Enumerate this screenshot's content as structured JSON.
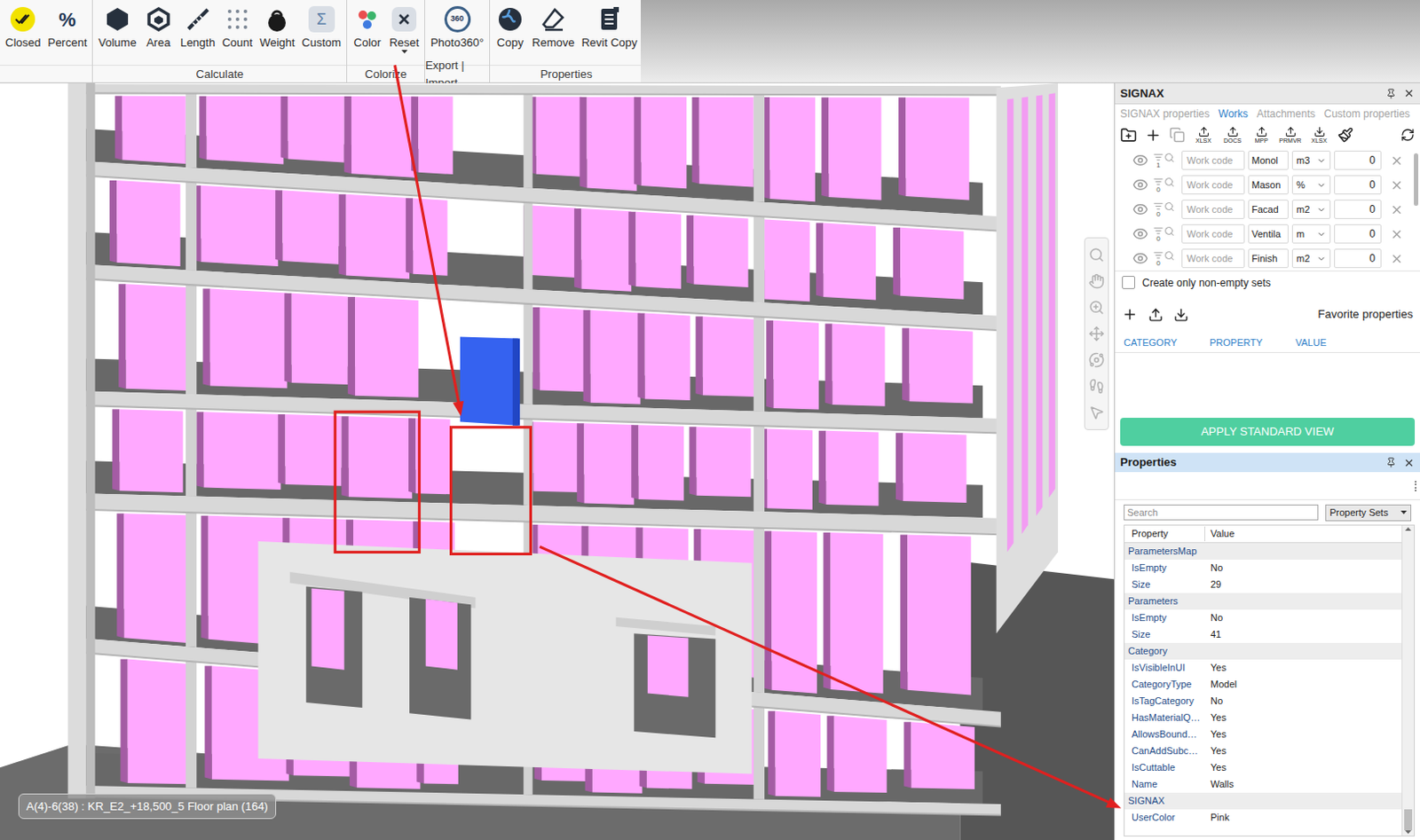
{
  "ribbon": {
    "groups": [
      {
        "buttons": [
          {
            "label": "Closed"
          },
          {
            "label": "Percent",
            "glyph": "%"
          }
        ]
      },
      {
        "label": "Calculate",
        "buttons": [
          {
            "label": "Volume"
          },
          {
            "label": "Area"
          },
          {
            "label": "Length"
          },
          {
            "label": "Count"
          },
          {
            "label": "Weight"
          },
          {
            "label": "Custom",
            "glyph": "Σ"
          }
        ]
      },
      {
        "label": "Colorize",
        "buttons": [
          {
            "label": "Color"
          },
          {
            "label": "Reset",
            "dropdown": true
          }
        ]
      },
      {
        "label": "Export | Import",
        "buttons": [
          {
            "label": "Photo360°",
            "glyph": "360"
          }
        ]
      },
      {
        "label": "Properties",
        "buttons": [
          {
            "label": "Copy"
          },
          {
            "label": "Remove"
          },
          {
            "label": "Revit Copy"
          }
        ]
      }
    ]
  },
  "viewport": {
    "status": "A(4)-6(38) : KR_E2_+18,500_5 Floor plan (164)"
  },
  "signax": {
    "title": "SIGNAX",
    "tabs": [
      {
        "label": "SIGNAX properties",
        "selected": false
      },
      {
        "label": "Works",
        "selected": true
      },
      {
        "label": "Attachments",
        "selected": false
      },
      {
        "label": "Custom properties",
        "selected": false
      }
    ],
    "transfers": [
      {
        "label": "XLSX",
        "kind": "upload"
      },
      {
        "label": "DOCS",
        "kind": "upload"
      },
      {
        "label": "MPP",
        "kind": "upload"
      },
      {
        "label": "PRMVR",
        "kind": "upload"
      },
      {
        "label": "XLSX",
        "kind": "download"
      }
    ],
    "works": [
      {
        "count": "1",
        "code": "Work code",
        "name": "Monol",
        "unit": "m3",
        "value": "0"
      },
      {
        "count": "0",
        "code": "Work code",
        "name": "Mason",
        "unit": "%",
        "value": "0"
      },
      {
        "count": "0",
        "code": "Work code",
        "name": "Facad",
        "unit": "m2",
        "value": "0"
      },
      {
        "count": "0",
        "code": "Work code",
        "name": "Ventila",
        "unit": "m",
        "value": "0"
      },
      {
        "count": "0",
        "code": "Work code",
        "name": "Finish",
        "unit": "m2",
        "value": "0"
      }
    ],
    "only_non_empty": {
      "label": "Create only non-empty sets",
      "checked": false
    },
    "favorites": {
      "title": "Favorite properties",
      "columns": [
        "CATEGORY",
        "PROPERTY",
        "VALUE"
      ]
    },
    "apply_button": "APPLY STANDARD VIEW"
  },
  "properties": {
    "title": "Properties",
    "search_placeholder": "Search",
    "dropdown": "Property Sets",
    "columns": [
      "Property",
      "Value"
    ],
    "rows": [
      {
        "kind": "group",
        "name": "ParametersMap"
      },
      {
        "kind": "prop",
        "name": "IsEmpty",
        "value": "No"
      },
      {
        "kind": "prop",
        "name": "Size",
        "value": "29"
      },
      {
        "kind": "group",
        "name": "Parameters"
      },
      {
        "kind": "prop",
        "name": "IsEmpty",
        "value": "No"
      },
      {
        "kind": "prop",
        "name": "Size",
        "value": "41"
      },
      {
        "kind": "group",
        "name": "Category"
      },
      {
        "kind": "prop",
        "name": "IsVisibleInUI",
        "value": "Yes"
      },
      {
        "kind": "prop",
        "name": "CategoryType",
        "value": "Model"
      },
      {
        "kind": "prop",
        "name": "IsTagCategory",
        "value": "No"
      },
      {
        "kind": "prop",
        "name": "HasMaterialQ…",
        "value": "Yes"
      },
      {
        "kind": "prop",
        "name": "AllowsBound…",
        "value": "Yes"
      },
      {
        "kind": "prop",
        "name": "CanAddSubc…",
        "value": "Yes"
      },
      {
        "kind": "prop",
        "name": "IsCuttable",
        "value": "Yes"
      },
      {
        "kind": "prop",
        "name": "Name",
        "value": "Walls"
      },
      {
        "kind": "group",
        "name": "SIGNAX"
      },
      {
        "kind": "prop",
        "name": "UserColor",
        "value": "Pink"
      }
    ]
  }
}
